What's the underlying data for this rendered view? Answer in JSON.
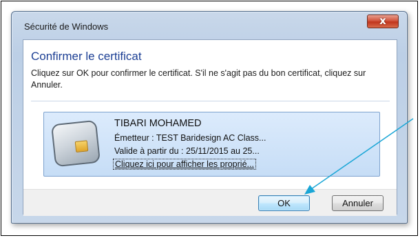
{
  "window": {
    "title": "Sécurité de Windows",
    "close_label": "x"
  },
  "dialog": {
    "heading": "Confirmer le certificat",
    "description": "Cliquez sur OK pour confirmer le certificat. S'il ne s'agit pas du bon certificat, cliquez sur Annuler."
  },
  "certificate": {
    "name": "TIBARI MOHAMED",
    "issuer": "Émetteur : TEST Baridesign AC Class...",
    "validity": "Valide à partir du : 25/11/2015 au 25...",
    "properties_link": "Cliquez ici pour afficher les proprié..."
  },
  "buttons": {
    "ok_label": "OK",
    "cancel_label": "Annuler"
  },
  "colors": {
    "heading": "#1c3f94",
    "annotation_arrow": "#1aa6d6"
  },
  "icons": {
    "certificate": "smart-card-icon",
    "close": "close-icon"
  }
}
